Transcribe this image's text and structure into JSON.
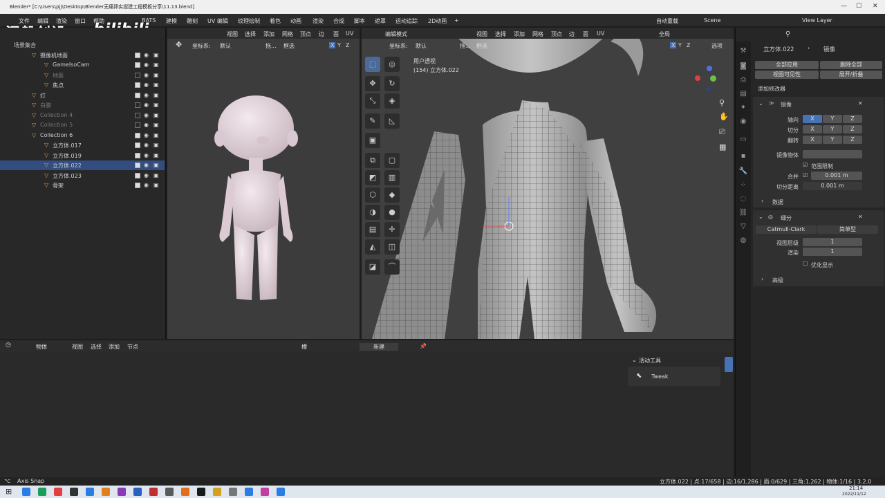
{
  "window": {
    "title": "Blender* [C:\\Users\\pjj\\Desktop\\Blender无痛卵实捏建工程模板分享\\11.13.blend]",
    "min": "—",
    "max": "☐",
    "close": "✕"
  },
  "menu": [
    "文件",
    "编辑",
    "渲染",
    "窗口",
    "帮助",
    "BATS",
    "建模",
    "雕刻",
    "UV 编辑",
    "纹理绘制",
    "着色",
    "动画",
    "渲染",
    "合成",
    "脚本",
    "遮罩",
    "运动追踪",
    "2D动画",
    "+"
  ],
  "menu_right": {
    "autosave": "自动重载",
    "scene": "Scene",
    "view_layer": "View Layer"
  },
  "watermark": {
    "text": "涅槃创设",
    "bili": "bilibili"
  },
  "outliner": {
    "root": "场景集合",
    "rows": [
      {
        "name": "摄像机地面",
        "dim": false,
        "indent": 2
      },
      {
        "name": "GameIsoCam",
        "dim": false,
        "indent": 4
      },
      {
        "name": "地面",
        "dim": true,
        "indent": 4
      },
      {
        "name": "焦点",
        "dim": false,
        "indent": 4
      },
      {
        "name": "灯",
        "dim": false,
        "indent": 2
      },
      {
        "name": "白膜",
        "dim": true,
        "indent": 2
      },
      {
        "name": "Collection 4",
        "dim": true,
        "indent": 2
      },
      {
        "name": "Collection 5",
        "dim": true,
        "indent": 2
      },
      {
        "name": "Collection 6",
        "dim": false,
        "indent": 2
      },
      {
        "name": "立方体.017",
        "dim": false,
        "indent": 4
      },
      {
        "name": "立方体.019",
        "dim": false,
        "indent": 4
      },
      {
        "name": "立方体.022",
        "dim": false,
        "indent": 4,
        "selected": true
      },
      {
        "name": "立方体.023",
        "dim": false,
        "indent": 4
      },
      {
        "name": "骨架",
        "dim": false,
        "indent": 4
      }
    ]
  },
  "vp1": {
    "menu": [
      "视图",
      "选择",
      "添加",
      "网格",
      "顶点",
      "边",
      "面",
      "UV"
    ],
    "coord_label": "坐标系:",
    "coord_value": "默认",
    "drag": "拖...",
    "select": "框选",
    "axes": [
      "X",
      "Y",
      "Z"
    ]
  },
  "vp2": {
    "mode": "编辑模式",
    "menu": [
      "视图",
      "选择",
      "添加",
      "网格",
      "顶点",
      "边",
      "面",
      "UV"
    ],
    "global": "全局",
    "coord_label": "坐标系:",
    "coord_value": "默认",
    "drag": "拖...",
    "select": "框选",
    "axes": [
      "X",
      "Y",
      "Z"
    ],
    "options": "选项",
    "view_name": "用户透视",
    "object_name": "(154) 立方体.022"
  },
  "props": {
    "object": "立方体.022",
    "modifier": "镜像",
    "apply_all": "全部应用",
    "delete_all": "删除全部",
    "viewport_vis": "视图可见性",
    "expand": "展开/折叠",
    "add_modifier": "添加修改器",
    "mirror": {
      "name": "镜像",
      "axis_label": "轴向",
      "bisect_label": "切分",
      "flip_label": "翻转",
      "x": "X",
      "y": "Y",
      "z": "Z",
      "mirror_obj": "镜像物体",
      "clip": "范围限制",
      "merge": "合并",
      "merge_val": "0.001 m",
      "bisect_dist": "切分距离",
      "bisect_val": "0.001 m",
      "data": "数据"
    },
    "subsurf": {
      "name": "细分",
      "catmull": "Catmull-Clark",
      "simple": "简单型",
      "levels_label": "视图层级",
      "levels_val": "1",
      "render_label": "渲染",
      "render_val": "1",
      "optimal": "优化显示",
      "advanced": "高级"
    }
  },
  "timeline": {
    "object": "物体",
    "menu": [
      "视图",
      "选择",
      "添加",
      "节点"
    ],
    "slot": "槽",
    "new": "新建",
    "active_tool": "活动工具",
    "tweak": "Tweak"
  },
  "status": {
    "left": "Axis Snap",
    "stats": "立方体.022 | 点:17/658 | 边:16/1,286 | 面:0/629 | 三角:1,262 | 物体:1/16 | 3.2.0"
  },
  "clock": {
    "time": "21:14",
    "date": "2022/11/12"
  }
}
